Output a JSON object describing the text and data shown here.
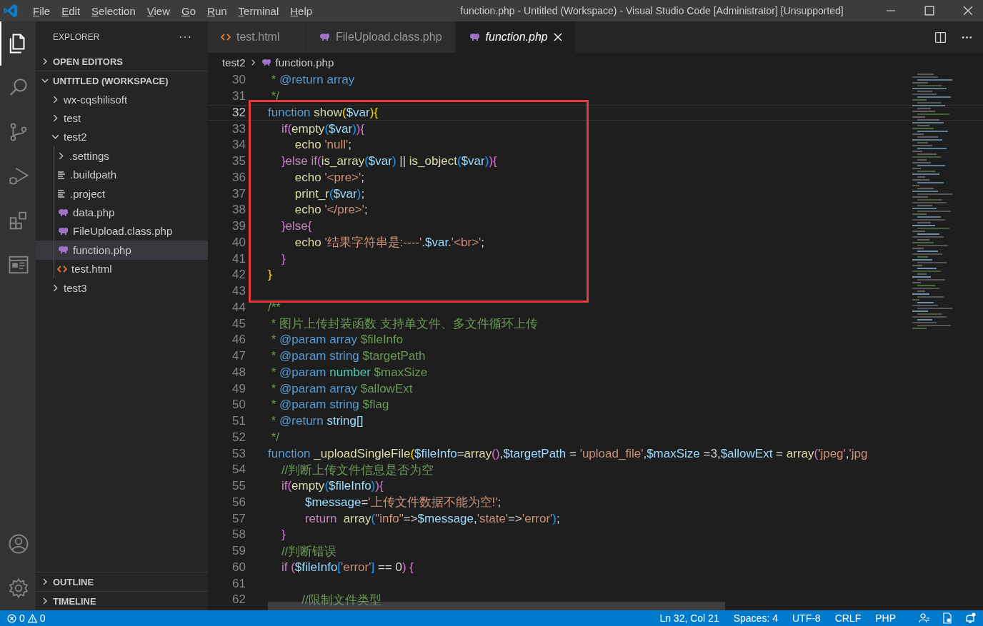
{
  "window": {
    "title": "function.php - Untitled (Workspace) - Visual Studio Code [Administrator] [Unsupported]"
  },
  "menu": [
    "File",
    "Edit",
    "Selection",
    "View",
    "Go",
    "Run",
    "Terminal",
    "Help"
  ],
  "activity_bar": [
    {
      "kind": "files",
      "selected": true
    },
    {
      "kind": "search",
      "selected": false
    },
    {
      "kind": "source-control",
      "selected": false
    },
    {
      "kind": "debug",
      "selected": false
    },
    {
      "kind": "extensions",
      "selected": false
    },
    {
      "kind": "remote",
      "selected": false
    }
  ],
  "sidebar": {
    "title": "EXPLORER",
    "more": "···",
    "sections": [
      {
        "label": "OPEN EDITORS",
        "expanded": false
      },
      {
        "label": "UNTITLED (WORKSPACE)",
        "expanded": true
      }
    ],
    "items": [
      {
        "label": "wx-cqshilisoft",
        "kind": "folder",
        "expanded": false,
        "selected": false
      },
      {
        "label": "test",
        "kind": "folder",
        "expanded": false,
        "selected": false
      },
      {
        "label": "test2",
        "kind": "folder",
        "expanded": true,
        "selected": false,
        "children": [
          {
            "label": ".settings",
            "kind": "folder",
            "expanded": false,
            "selected": false
          },
          {
            "label": ".buildpath",
            "kind": "text",
            "selected": false
          },
          {
            "label": ".project",
            "kind": "text",
            "selected": false
          },
          {
            "label": "data.php",
            "kind": "php",
            "selected": false
          },
          {
            "label": "FileUpload.class.php",
            "kind": "php",
            "selected": false
          },
          {
            "label": "function.php",
            "kind": "php",
            "selected": true
          },
          {
            "label": "test.html",
            "kind": "html",
            "selected": false
          }
        ]
      },
      {
        "label": "test3",
        "kind": "folder",
        "expanded": false,
        "selected": false
      }
    ],
    "bottom_sections": [
      {
        "label": "OUTLINE",
        "expanded": false
      },
      {
        "label": "TIMELINE",
        "expanded": false
      }
    ]
  },
  "tabs": [
    {
      "label": "test.html",
      "kind": "html",
      "selected": false,
      "preview": false
    },
    {
      "label": "FileUpload.class.php",
      "kind": "php",
      "selected": false,
      "preview": false
    },
    {
      "label": "function.php",
      "kind": "php",
      "selected": true,
      "preview": true
    }
  ],
  "breadcrumbs": [
    "test2",
    "function.php"
  ],
  "code": [
    {
      "n": "30",
      "current": false,
      "t": [
        {
          "kind": "c",
          "text": " * "
        },
        {
          "kind": "kw",
          "text": "@return array"
        }
      ]
    },
    {
      "n": "31",
      "current": false,
      "t": [
        {
          "kind": "c",
          "text": " */"
        }
      ]
    },
    {
      "n": "32",
      "current": true,
      "t": [
        {
          "kind": "kw",
          "text": "function"
        },
        {
          "kind": "fn",
          "text": " show"
        },
        {
          "kind": "b1",
          "text": "("
        },
        {
          "kind": "v",
          "text": "$var"
        },
        {
          "kind": "b1",
          "text": ")"
        },
        {
          "kind": "b1",
          "text": "{"
        }
      ]
    },
    {
      "n": "33",
      "current": false,
      "t": [
        {
          "kind": "ctl",
          "text": "    if"
        },
        {
          "kind": "b2",
          "text": "("
        },
        {
          "kind": "fn",
          "text": "empty"
        },
        {
          "kind": "b3",
          "text": "("
        },
        {
          "kind": "v",
          "text": "$var"
        },
        {
          "kind": "b3",
          "text": ")"
        },
        {
          "kind": "b2",
          "text": ")"
        },
        {
          "kind": "b2",
          "text": "{"
        }
      ]
    },
    {
      "n": "34",
      "current": false,
      "t": [
        {
          "kind": "fn",
          "text": "        echo "
        },
        {
          "kind": "s",
          "text": "'null'"
        },
        {
          "kind": "p",
          "text": ";"
        }
      ]
    },
    {
      "n": "35",
      "current": false,
      "t": [
        {
          "kind": "b2",
          "text": "    }"
        },
        {
          "kind": "ctl",
          "text": "else if"
        },
        {
          "kind": "b2",
          "text": "("
        },
        {
          "kind": "fn",
          "text": "is_array"
        },
        {
          "kind": "b3",
          "text": "("
        },
        {
          "kind": "v",
          "text": "$var"
        },
        {
          "kind": "b3",
          "text": ")"
        },
        {
          "kind": "p",
          "text": " || "
        },
        {
          "kind": "fn",
          "text": "is_object"
        },
        {
          "kind": "b3",
          "text": "("
        },
        {
          "kind": "v",
          "text": "$var"
        },
        {
          "kind": "b3",
          "text": ")"
        },
        {
          "kind": "b2",
          "text": ")"
        },
        {
          "kind": "b2",
          "text": "{"
        }
      ]
    },
    {
      "n": "36",
      "current": false,
      "t": [
        {
          "kind": "fn",
          "text": "        echo "
        },
        {
          "kind": "s",
          "text": "'<pre>'"
        },
        {
          "kind": "p",
          "text": ";"
        }
      ]
    },
    {
      "n": "37",
      "current": false,
      "t": [
        {
          "kind": "fn",
          "text": "        print_r"
        },
        {
          "kind": "b3",
          "text": "("
        },
        {
          "kind": "v",
          "text": "$var"
        },
        {
          "kind": "b3",
          "text": ")"
        },
        {
          "kind": "p",
          "text": ";"
        }
      ]
    },
    {
      "n": "38",
      "current": false,
      "t": [
        {
          "kind": "fn",
          "text": "        echo "
        },
        {
          "kind": "s",
          "text": "'</pre>'"
        },
        {
          "kind": "p",
          "text": ";"
        }
      ]
    },
    {
      "n": "39",
      "current": false,
      "t": [
        {
          "kind": "b2",
          "text": "    }"
        },
        {
          "kind": "ctl",
          "text": "else"
        },
        {
          "kind": "b2",
          "text": "{"
        }
      ]
    },
    {
      "n": "40",
      "current": false,
      "t": [
        {
          "kind": "fn",
          "text": "        echo "
        },
        {
          "kind": "s",
          "text": "'结果字符串是:----'"
        },
        {
          "kind": "p",
          "text": "."
        },
        {
          "kind": "v",
          "text": "$var"
        },
        {
          "kind": "p",
          "text": "."
        },
        {
          "kind": "s",
          "text": "'<br>'"
        },
        {
          "kind": "p",
          "text": ";"
        }
      ]
    },
    {
      "n": "41",
      "current": false,
      "t": [
        {
          "kind": "b2",
          "text": "    }"
        }
      ]
    },
    {
      "n": "42",
      "current": false,
      "t": [
        {
          "kind": "b1",
          "text": "}"
        }
      ]
    },
    {
      "n": "43",
      "current": false
    },
    {
      "n": "44",
      "current": false,
      "t": [
        {
          "kind": "c",
          "text": "/**"
        }
      ]
    },
    {
      "n": "45",
      "current": false,
      "t": [
        {
          "kind": "c",
          "text": " * 图片上传封装函数 支持单文件、多文件循环上传"
        }
      ]
    },
    {
      "n": "46",
      "current": false,
      "t": [
        {
          "kind": "c",
          "text": " * "
        },
        {
          "kind": "kw",
          "text": "@param array"
        },
        {
          "kind": "c",
          "text": " $fileInfo"
        }
      ]
    },
    {
      "n": "47",
      "current": false,
      "t": [
        {
          "kind": "c",
          "text": " * "
        },
        {
          "kind": "kw",
          "text": "@param string"
        },
        {
          "kind": "c",
          "text": " $targetPath"
        }
      ]
    },
    {
      "n": "48",
      "current": false,
      "t": [
        {
          "kind": "c",
          "text": " * "
        },
        {
          "kind": "kw",
          "text": "@param"
        },
        {
          "kind": "ty",
          "text": " number"
        },
        {
          "kind": "c",
          "text": " $maxSize"
        }
      ]
    },
    {
      "n": "49",
      "current": false,
      "t": [
        {
          "kind": "c",
          "text": " * "
        },
        {
          "kind": "kw",
          "text": "@param array"
        },
        {
          "kind": "c",
          "text": " $allowExt"
        }
      ]
    },
    {
      "n": "50",
      "current": false,
      "t": [
        {
          "kind": "c",
          "text": " * "
        },
        {
          "kind": "kw",
          "text": "@param string"
        },
        {
          "kind": "c",
          "text": " $flag"
        }
      ]
    },
    {
      "n": "51",
      "current": false,
      "t": [
        {
          "kind": "c",
          "text": " * "
        },
        {
          "kind": "kw",
          "text": "@return"
        },
        {
          "kind": "v",
          "text": " string[]"
        }
      ]
    },
    {
      "n": "52",
      "current": false,
      "t": [
        {
          "kind": "c",
          "text": " */"
        }
      ]
    },
    {
      "n": "53",
      "current": false,
      "t": [
        {
          "kind": "kw",
          "text": "function"
        },
        {
          "kind": "fn",
          "text": " _uploadSingleFile"
        },
        {
          "kind": "b1",
          "text": "("
        },
        {
          "kind": "v",
          "text": "$fileInfo"
        },
        {
          "kind": "p",
          "text": "="
        },
        {
          "kind": "fn",
          "text": "array"
        },
        {
          "kind": "b2",
          "text": "()"
        },
        {
          "kind": "p",
          "text": ","
        },
        {
          "kind": "v",
          "text": "$targetPath"
        },
        {
          "kind": "p",
          "text": " = "
        },
        {
          "kind": "s",
          "text": "'upload_file'"
        },
        {
          "kind": "p",
          "text": ","
        },
        {
          "kind": "v",
          "text": "$maxSize"
        },
        {
          "kind": "p",
          "text": " =3,"
        },
        {
          "kind": "v",
          "text": "$allowExt"
        },
        {
          "kind": "p",
          "text": " = "
        },
        {
          "kind": "fn",
          "text": "array"
        },
        {
          "kind": "b2",
          "text": "("
        },
        {
          "kind": "s",
          "text": "'jpeg'"
        },
        {
          "kind": "p",
          "text": ","
        },
        {
          "kind": "s",
          "text": "'jpg"
        }
      ]
    },
    {
      "n": "54",
      "current": false,
      "t": [
        {
          "kind": "c",
          "text": "    //判断上传文件信息是否为空"
        }
      ]
    },
    {
      "n": "55",
      "current": false,
      "t": [
        {
          "kind": "ctl",
          "text": "    if"
        },
        {
          "kind": "b2",
          "text": "("
        },
        {
          "kind": "fn",
          "text": "empty"
        },
        {
          "kind": "b3",
          "text": "("
        },
        {
          "kind": "v",
          "text": "$fileInfo"
        },
        {
          "kind": "b3",
          "text": ")"
        },
        {
          "kind": "b2",
          "text": ")"
        },
        {
          "kind": "b2",
          "text": "{"
        }
      ]
    },
    {
      "n": "56",
      "current": false,
      "t": [
        {
          "kind": "v",
          "text": "           $message"
        },
        {
          "kind": "p",
          "text": "="
        },
        {
          "kind": "s",
          "text": "'上传文件数据不能为空!'"
        },
        {
          "kind": "p",
          "text": ";"
        }
      ]
    },
    {
      "n": "57",
      "current": false,
      "t": [
        {
          "kind": "ctl",
          "text": "           return  "
        },
        {
          "kind": "fn",
          "text": "array"
        },
        {
          "kind": "b3",
          "text": "("
        },
        {
          "kind": "s",
          "text": "\"info\""
        },
        {
          "kind": "p",
          "text": "=>"
        },
        {
          "kind": "v",
          "text": "$message"
        },
        {
          "kind": "p",
          "text": ","
        },
        {
          "kind": "s",
          "text": "'state'"
        },
        {
          "kind": "p",
          "text": "=>"
        },
        {
          "kind": "s",
          "text": "'error'"
        },
        {
          "kind": "b3",
          "text": ")"
        },
        {
          "kind": "p",
          "text": ";"
        }
      ]
    },
    {
      "n": "58",
      "current": false,
      "t": [
        {
          "kind": "b2",
          "text": "    }"
        }
      ]
    },
    {
      "n": "59",
      "current": false,
      "t": [
        {
          "kind": "c",
          "text": "    //判断错误"
        }
      ]
    },
    {
      "n": "60",
      "current": false,
      "t": [
        {
          "kind": "ctl",
          "text": "    if "
        },
        {
          "kind": "b2",
          "text": "("
        },
        {
          "kind": "v",
          "text": "$fileInfo"
        },
        {
          "kind": "b3",
          "text": "["
        },
        {
          "kind": "s",
          "text": "'error'"
        },
        {
          "kind": "b3",
          "text": "]"
        },
        {
          "kind": "p",
          "text": " == 0"
        },
        {
          "kind": "b2",
          "text": ")"
        },
        {
          "kind": "b2",
          "text": " {"
        }
      ]
    },
    {
      "n": "61",
      "current": false
    },
    {
      "n": "62",
      "current": false,
      "t": [
        {
          "kind": "c",
          "text": "          //限制文件类型"
        }
      ]
    }
  ],
  "status_bar": {
    "errors": "0",
    "warnings": "0",
    "items": [
      "Ln 32, Col 21",
      "Spaces: 4",
      "UTF-8",
      "CRLF",
      "PHP"
    ]
  }
}
